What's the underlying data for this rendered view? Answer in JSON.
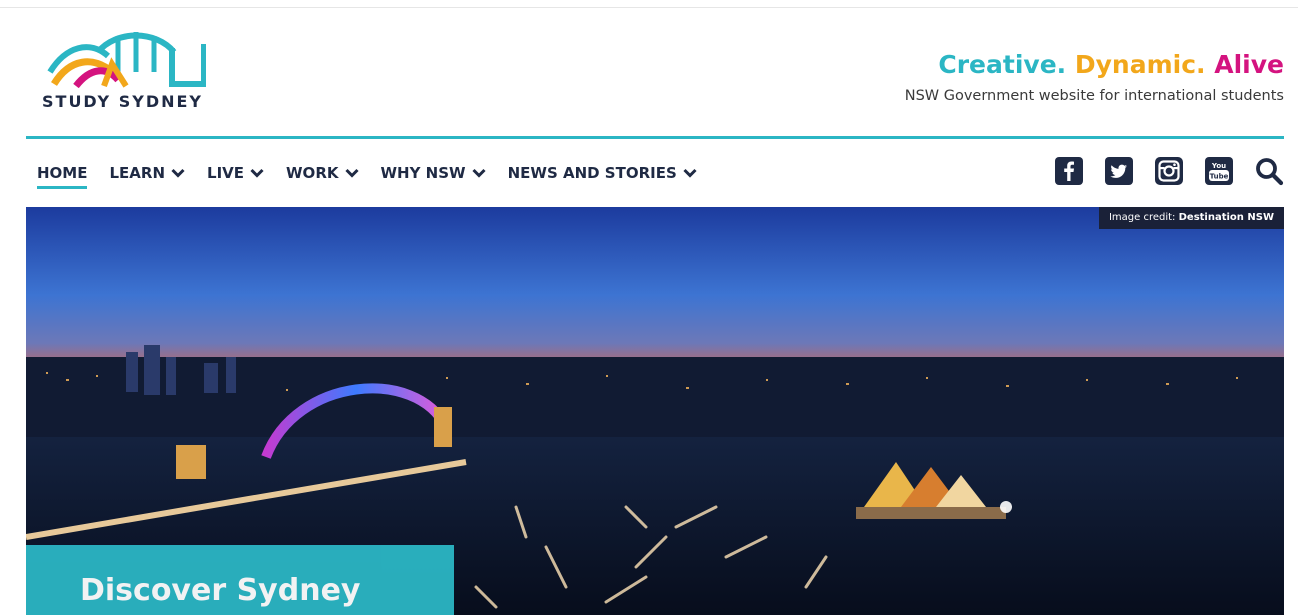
{
  "logo": {
    "text": "STUDY SYDNEY"
  },
  "tagline": {
    "part1": "Creative.",
    "part2": "Dynamic.",
    "part3": "Alive",
    "sub": "NSW Government website for international students"
  },
  "nav": {
    "items": [
      {
        "label": "HOME",
        "active": true,
        "dropdown": false
      },
      {
        "label": "LEARN",
        "active": false,
        "dropdown": true
      },
      {
        "label": "LIVE",
        "active": false,
        "dropdown": true
      },
      {
        "label": "WORK",
        "active": false,
        "dropdown": true
      },
      {
        "label": "WHY NSW",
        "active": false,
        "dropdown": true
      },
      {
        "label": "NEWS AND STORIES",
        "active": false,
        "dropdown": true
      }
    ],
    "social": [
      "facebook-icon",
      "twitter-icon",
      "instagram-icon",
      "youtube-icon",
      "search-icon"
    ]
  },
  "hero": {
    "credit_label": "Image credit:",
    "credit_source": "Destination NSW",
    "cta": "Discover Sydney"
  },
  "colors": {
    "teal": "#2bb6c4",
    "gold": "#f2a71b",
    "magenta": "#d4137f",
    "navy": "#1f2a44"
  }
}
